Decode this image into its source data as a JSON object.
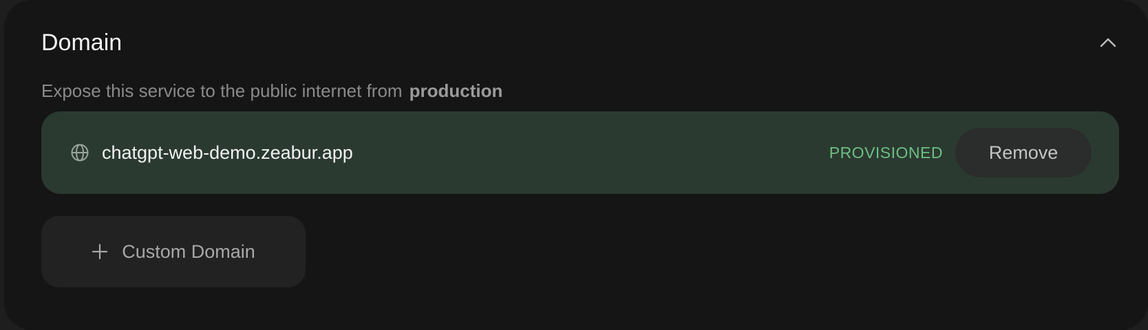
{
  "section": {
    "title": "Domain",
    "collapse_icon": "chevron-up-icon"
  },
  "description": {
    "text": "Expose this service to the public internet from",
    "environment": "production"
  },
  "domains": [
    {
      "icon": "globe-icon",
      "name": "chatgpt-web-demo.zeabur.app",
      "status": "PROVISIONED",
      "remove_label": "Remove"
    }
  ],
  "actions": {
    "custom_domain_icon": "plus-icon",
    "custom_domain_label": "Custom Domain"
  },
  "colors": {
    "card_background": "#151515",
    "domain_row_background": "#2b3a31",
    "status_green": "#6cbf82",
    "button_background": "#222222"
  }
}
